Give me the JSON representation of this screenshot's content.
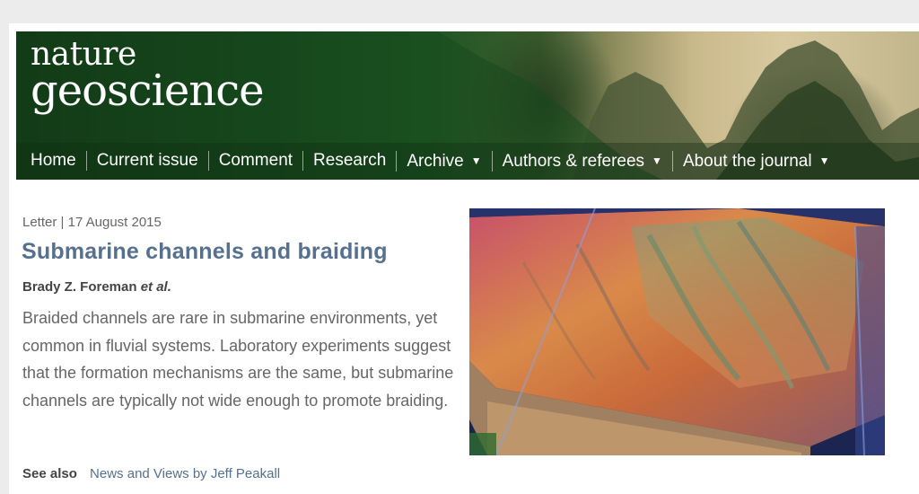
{
  "logo": {
    "line1": "nature",
    "line2": "geoscience"
  },
  "nav": {
    "items": [
      {
        "label": "Home",
        "dropdown": false
      },
      {
        "label": "Current issue",
        "dropdown": false
      },
      {
        "label": "Comment",
        "dropdown": false
      },
      {
        "label": "Research",
        "dropdown": false
      },
      {
        "label": "Archive",
        "dropdown": true
      },
      {
        "label": "Authors & referees",
        "dropdown": true
      },
      {
        "label": "About the journal",
        "dropdown": true
      }
    ],
    "caret": "▼"
  },
  "article": {
    "type": "Letter",
    "separator": "|",
    "date": "17 August 2015",
    "title": "Submarine channels and braiding",
    "author": "Brady Z. Foreman",
    "author_suffix": "et al.",
    "summary": "Braided channels are rare in submarine environments, yet common in fluvial systems. Laboratory experiments suggest that the formation mechanisms are the same, but submarine channels are typically not wide enough to promote braiding.",
    "see_also_label": "See also",
    "see_also_link": "News and Views by Jeff Peakall"
  },
  "colors": {
    "title": "#56708f",
    "link": "#56708f",
    "body_text": "#666666",
    "nav_text": "#ffffff"
  }
}
